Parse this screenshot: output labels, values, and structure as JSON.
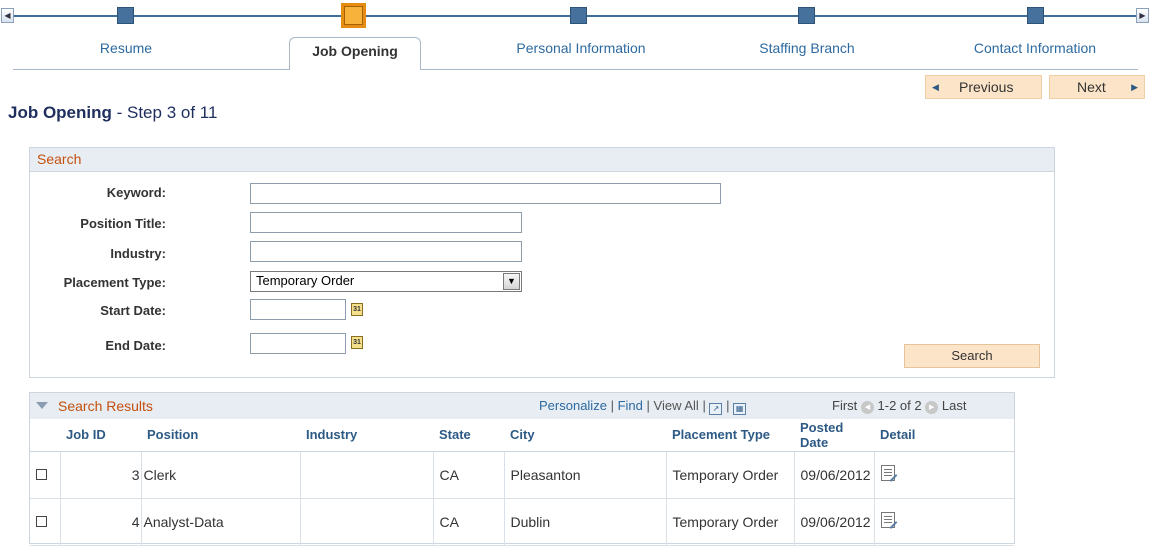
{
  "train": {
    "scroll_left_icon": "◀",
    "scroll_right_icon": "▶",
    "steps": [
      {
        "label": "Resume",
        "active": false
      },
      {
        "label": "Job Opening",
        "active": true
      },
      {
        "label": "Personal Information",
        "active": false
      },
      {
        "label": "Staffing Branch",
        "active": false
      },
      {
        "label": "Contact Information",
        "active": false
      }
    ]
  },
  "nav": {
    "previous_label": "Previous",
    "next_label": "Next",
    "previous_icon": "◀",
    "next_icon": "▶"
  },
  "page": {
    "title": "Job Opening",
    "step_text": " - Step 3 of 11"
  },
  "search": {
    "header": "Search",
    "fields": {
      "keyword_label": "Keyword:",
      "keyword_value": "",
      "position_title_label": "Position Title:",
      "position_title_value": "",
      "industry_label": "Industry:",
      "industry_value": "",
      "placement_type_label": "Placement Type:",
      "placement_type_value": "Temporary Order",
      "start_date_label": "Start Date:",
      "start_date_value": "",
      "end_date_label": "End Date:",
      "end_date_value": ""
    },
    "calendar_icon_text": "31",
    "button_label": "Search"
  },
  "results": {
    "title": "Search Results",
    "tools": {
      "personalize": "Personalize",
      "find": "Find",
      "view_all": "View All",
      "sep": "|"
    },
    "pager": {
      "first": "First",
      "range": "1-2 of 2",
      "last": "Last"
    },
    "columns": [
      "Job ID",
      "Position",
      "Industry",
      "State",
      "City",
      "Placement Type",
      "Posted Date",
      "Detail"
    ],
    "rows": [
      {
        "job_id": "3",
        "position": "Clerk",
        "industry": "",
        "state": "CA",
        "city": "Pleasanton",
        "placement_type": "Temporary Order",
        "posted_date": "09/06/2012"
      },
      {
        "job_id": "4",
        "position": "Analyst-Data",
        "industry": "",
        "state": "CA",
        "city": "Dublin",
        "placement_type": "Temporary Order",
        "posted_date": "09/06/2012"
      }
    ]
  },
  "colors": {
    "accent_orange": "#c4500e",
    "link_blue": "#2d6aa0",
    "step_blue": "#45719c",
    "active_step": "#f7b23b",
    "button_bg": "#fce4c8"
  }
}
